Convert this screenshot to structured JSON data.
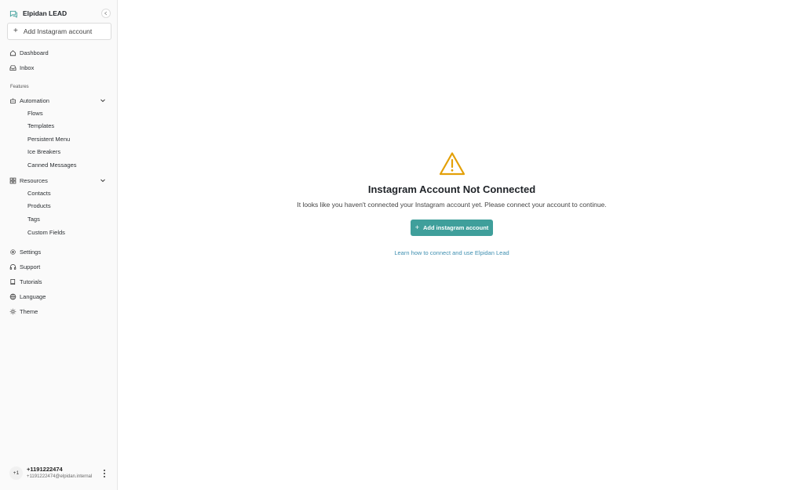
{
  "sidebar": {
    "brand": "Elpidan LEAD",
    "add_account_label": "Add Instagram account",
    "nav_top": [
      {
        "label": "Dashboard",
        "icon": "home-icon"
      },
      {
        "label": "Inbox",
        "icon": "inbox-icon"
      }
    ],
    "features_label": "Features",
    "automation": {
      "label": "Automation",
      "items": [
        "Flows",
        "Templates",
        "Persistent Menu",
        "Ice Breakers",
        "Canned Messages"
      ]
    },
    "resources": {
      "label": "Resources",
      "items": [
        "Contacts",
        "Products",
        "Tags",
        "Custom Fields"
      ]
    },
    "nav_bottom": [
      {
        "label": "Settings",
        "icon": "gear-icon"
      },
      {
        "label": "Support",
        "icon": "headphones-icon"
      },
      {
        "label": "Tutorials",
        "icon": "book-icon"
      },
      {
        "label": "Language",
        "icon": "globe-icon"
      },
      {
        "label": "Theme",
        "icon": "sun-icon"
      }
    ],
    "user": {
      "avatar": "+1",
      "name": "+1191222474",
      "email": "+1191222474@elpidan.internal"
    }
  },
  "main": {
    "title": "Instagram Account Not Connected",
    "description": "It looks like you haven't connected your Instagram account yet. Please connect your account to continue.",
    "cta_label": "Add instagram account",
    "learn_link": "Learn how to connect and use Elpidan Lead"
  },
  "colors": {
    "accent": "#3f9f9b",
    "warning": "#e3a008",
    "link": "#3f8fb0",
    "sidebar_bg": "#fafafa"
  }
}
